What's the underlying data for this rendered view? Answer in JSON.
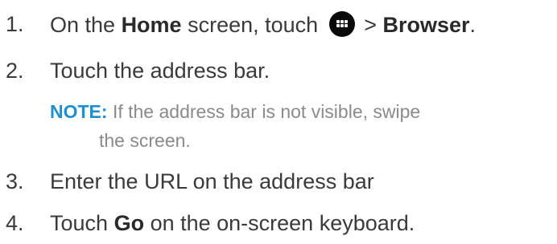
{
  "steps": [
    {
      "number": "1.",
      "before": "On the ",
      "home": "Home",
      "middle": " screen, touch ",
      "icon": "apps-grid-icon",
      "gt": " > ",
      "browser": "Browser",
      "end": "."
    },
    {
      "number": "2.",
      "text": "Touch the address bar."
    },
    {
      "number": "3.",
      "text": "Enter the URL on the address bar"
    },
    {
      "number": "4.",
      "before": "Touch ",
      "go": "Go",
      "after": " on the on-screen keyboard."
    }
  ],
  "note": {
    "label": "NOTE:",
    "line1": " If the address bar is not visible, swipe",
    "line2": "the screen."
  },
  "colors": {
    "text": "#3a3a3a",
    "note_label": "#1e8fcf",
    "note_text": "#8a8a8a",
    "icon_bg": "#0a0a0a"
  }
}
